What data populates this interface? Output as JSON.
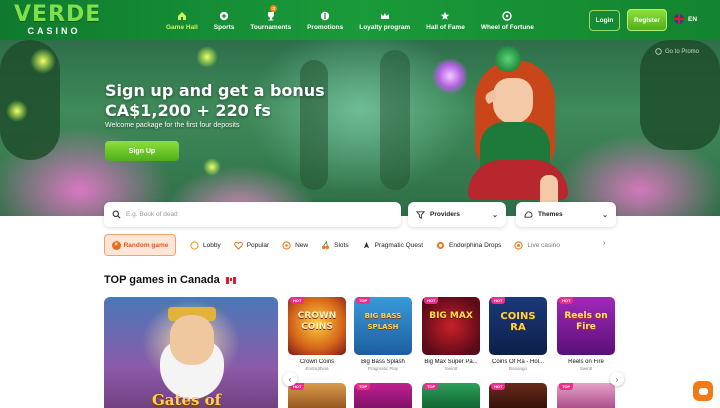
{
  "brand": {
    "logo_top": "VERDE",
    "logo_bottom": "CASINO"
  },
  "nav": {
    "items": [
      {
        "label": "Game Hall",
        "icon": "home-icon",
        "active": true
      },
      {
        "label": "Sports",
        "icon": "soccer-ball-icon"
      },
      {
        "label": "Tournaments",
        "icon": "trophy-icon",
        "badge": "3"
      },
      {
        "label": "Promotions",
        "icon": "gift-icon"
      },
      {
        "label": "Loyalty program",
        "icon": "crown-icon"
      },
      {
        "label": "Hall of Fame",
        "icon": "star-icon"
      },
      {
        "label": "Wheel of Fortune",
        "icon": "wheel-icon"
      }
    ]
  },
  "auth": {
    "login_label": "Login",
    "register_label": "Register"
  },
  "language": {
    "code": "EN",
    "flag": "uk-flag-icon"
  },
  "hero": {
    "title_line1": "Sign up and get a bonus",
    "title_line2": "CA$1,200 + 220 fs",
    "subtitle": "Welcome package for the first four deposits",
    "cta_label": "Sign Up",
    "promo_link": "Go to Promo"
  },
  "search": {
    "placeholder": "E.g. Book of dead",
    "icon": "search-icon"
  },
  "filters": {
    "providers_label": "Providers",
    "themes_label": "Themes"
  },
  "categories": {
    "random_label": "Random game",
    "items": [
      {
        "label": "Lobby",
        "icon": "smile-icon"
      },
      {
        "label": "Popular",
        "icon": "heart-icon"
      },
      {
        "label": "New",
        "icon": "new-icon"
      },
      {
        "label": "Slots",
        "icon": "cherry-icon"
      },
      {
        "label": "Pragmatic Quest",
        "icon": "rocket-icon"
      },
      {
        "label": "Endorphina Drops",
        "icon": "drop-icon"
      },
      {
        "label": "Live casino",
        "icon": "live-icon"
      }
    ]
  },
  "section": {
    "title": "TOP games in Canada",
    "flag": "canada-flag-icon"
  },
  "featured": {
    "name": "Gates of Olympus",
    "visible_text": "Gates of"
  },
  "games": [
    {
      "name": "Crown Coins",
      "provider": "Endorphina",
      "tag": "HOT",
      "art_text": "CROWN COINS"
    },
    {
      "name": "Big Bass Splash",
      "provider": "Pragmatic Play",
      "tag": "TOP",
      "art_text": "BIG BASS SPLASH"
    },
    {
      "name": "Big Max Super Pa...",
      "provider": "Swintt",
      "tag": "HOT",
      "art_text": "BIG MAX"
    },
    {
      "name": "Coins Of Ra - Hol...",
      "provider": "Booongo",
      "tag": "HOT",
      "art_text": "COINS RA"
    },
    {
      "name": "Reels on Fire",
      "provider": "Swintt",
      "tag": "HOT",
      "art_text": "Reels on Fire"
    }
  ],
  "second_row_tags": [
    "HOT",
    "TOP",
    "TOP",
    "HOT",
    "TOP"
  ],
  "colors": {
    "brand_green": "#1a9a3a",
    "accent_lime": "#8be03a",
    "random_orange": "#f06a1a",
    "hot_pink": "#e8308a"
  }
}
